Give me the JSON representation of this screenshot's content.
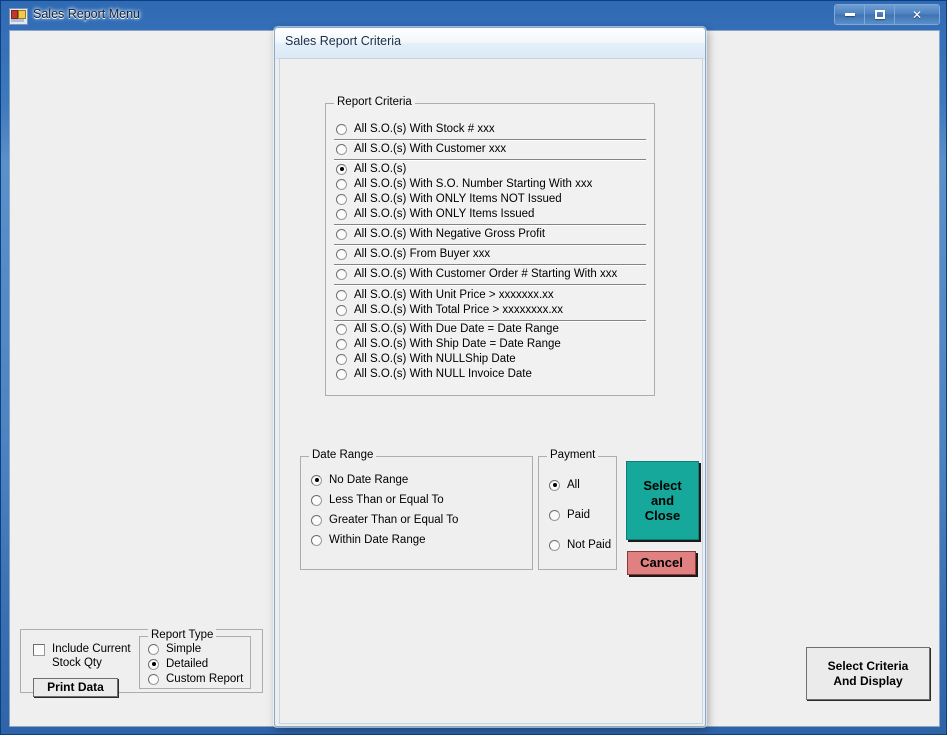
{
  "main_window": {
    "title": "Sales Report Menu",
    "icon": "form-icon",
    "controls": {
      "minimize": "minimize-icon",
      "maximize": "maximize-icon",
      "close": "✕"
    }
  },
  "dialog": {
    "title": "Sales Report Criteria",
    "report_criteria": {
      "legend": "Report Criteria",
      "options": [
        {
          "label": "All S.O.(s) With Stock # xxx",
          "checked": false
        },
        {
          "label": "All S.O.(s) With Customer xxx",
          "checked": false
        },
        {
          "label": "All S.O.(s)",
          "checked": true
        },
        {
          "label": "All S.O.(s) With S.O. Number Starting With xxx",
          "checked": false
        },
        {
          "label": "All S.O.(s) With ONLY Items NOT Issued",
          "checked": false
        },
        {
          "label": "All S.O.(s) With ONLY Items Issued",
          "checked": false
        },
        {
          "label": "All S.O.(s) With Negative Gross Profit",
          "checked": false
        },
        {
          "label": "All S.O.(s) From Buyer xxx",
          "checked": false
        },
        {
          "label": "All S.O.(s) With Customer Order # Starting With xxx",
          "checked": false
        },
        {
          "label": "All S.O.(s) With  Unit Price > xxxxxxx.xx",
          "checked": false
        },
        {
          "label": "All S.O.(s) With Total Price > xxxxxxxx.xx",
          "checked": false
        },
        {
          "label": "All S.O.(s) With Due Date = Date Range",
          "checked": false
        },
        {
          "label": "All S.O.(s) With Ship Date = Date Range",
          "checked": false
        },
        {
          "label": "All S.O.(s) With NULLShip Date",
          "checked": false
        },
        {
          "label": "All S.O.(s) With NULL Invoice Date",
          "checked": false
        }
      ]
    },
    "date_range": {
      "legend": "Date Range",
      "options": [
        {
          "label": "No Date Range",
          "checked": true
        },
        {
          "label": "Less Than or Equal To",
          "checked": false
        },
        {
          "label": "Greater Than or Equal To",
          "checked": false
        },
        {
          "label": "Within Date Range",
          "checked": false
        }
      ]
    },
    "payment": {
      "legend": "Payment",
      "options": [
        {
          "label": "All",
          "checked": true
        },
        {
          "label": "Paid",
          "checked": false
        },
        {
          "label": "Not Paid",
          "checked": false
        }
      ]
    },
    "buttons": {
      "select_and_close": "Select\nand\nClose",
      "select_and_close_line1": "Select",
      "select_and_close_line2": "and",
      "select_and_close_line3": "Close",
      "cancel": "Cancel"
    },
    "colors": {
      "select_and_close_bg": "#16a99b",
      "cancel_bg": "#e08080"
    }
  },
  "bottom_left_panel": {
    "include_current_stock_qty": {
      "label_line1": "Include Current",
      "label_line2": "Stock Qty",
      "checked": false
    },
    "print_data_button": "Print Data",
    "report_type": {
      "legend": "Report Type",
      "options": [
        {
          "label": "Simple",
          "checked": false
        },
        {
          "label": "Detailed",
          "checked": true
        },
        {
          "label": "Custom Report",
          "checked": false
        }
      ]
    }
  },
  "bottom_right_button": {
    "line1": "Select Criteria",
    "line2": "And Display"
  }
}
